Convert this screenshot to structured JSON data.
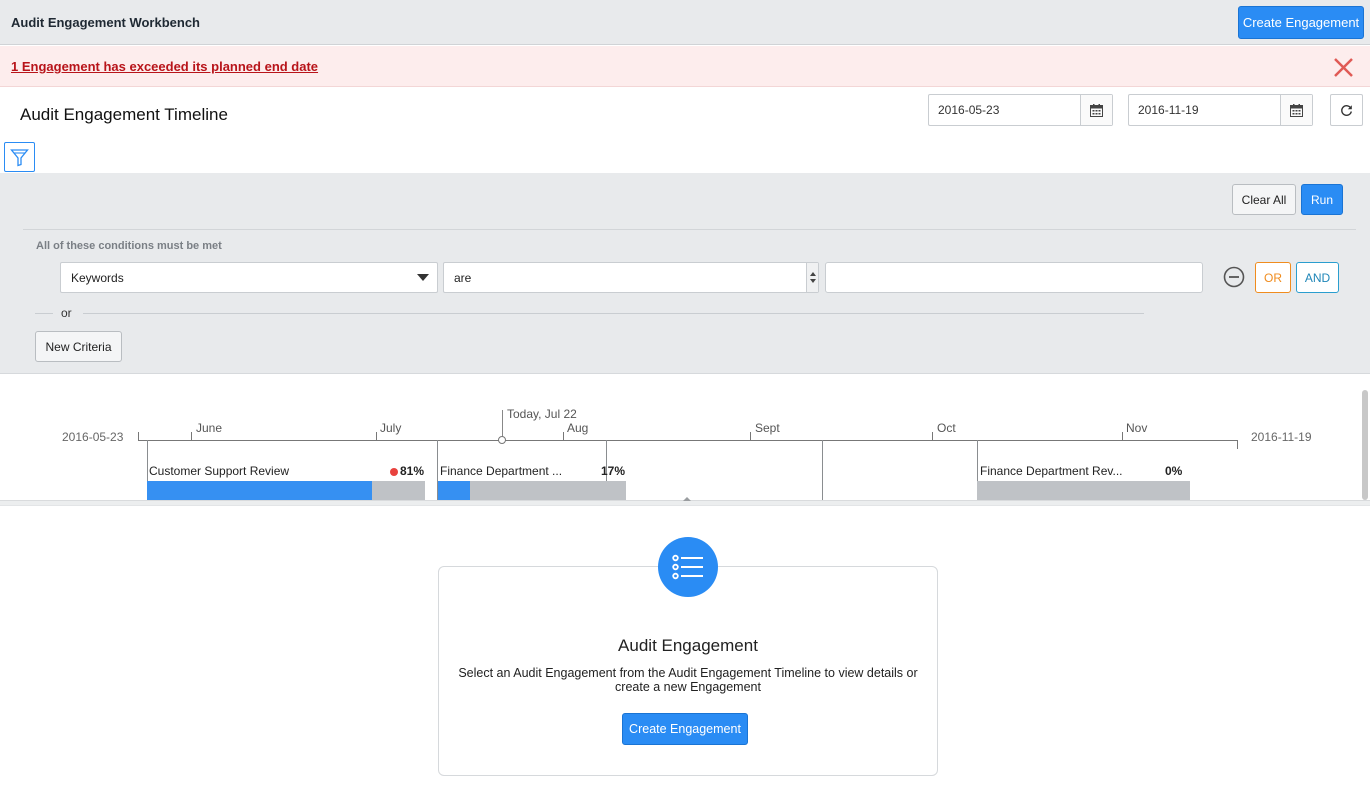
{
  "header": {
    "title": "Audit Engagement Workbench",
    "create_label": "Create Engagement"
  },
  "alert": {
    "message": "1 Engagement has exceeded its planned end date",
    "close_icon": "close-icon"
  },
  "page": {
    "title": "Audit Engagement Timeline"
  },
  "date_range": {
    "start": "2016-05-23",
    "end": "2016-11-19"
  },
  "filter": {
    "clear_all_label": "Clear All",
    "run_label": "Run",
    "conditions_label": "All of these conditions must be met",
    "field_value": "Keywords",
    "operator_value": "are",
    "text_value": "",
    "or_button": "OR",
    "and_button": "AND",
    "or_divider": "or",
    "new_criteria_label": "New Criteria"
  },
  "timeline": {
    "start_label": "2016-05-23",
    "end_label": "2016-11-19",
    "months": [
      "June",
      "July",
      "Aug",
      "Sept",
      "Oct",
      "Nov"
    ],
    "today_label": "Today, Jul 22",
    "tasks": [
      {
        "name": "Customer Support Review",
        "percent": "81%",
        "progress": 0.81,
        "overdue": true
      },
      {
        "name": "Finance Department ...",
        "percent": "17%",
        "progress": 0.17,
        "overdue": false
      },
      {
        "name": "Finance Department Rev...",
        "percent": "0%",
        "progress": 0.0,
        "overdue": false
      }
    ]
  },
  "detail": {
    "title": "Audit Engagement",
    "description": "Select an Audit Engagement from the Audit Engagement Timeline to view details or create a new Engagement",
    "create_label": "Create Engagement"
  },
  "colors": {
    "primary": "#2a8cf4",
    "alert_text": "#b8141a",
    "alert_bg": "#fdeded",
    "or_accent": "#f08c1e",
    "and_accent": "#1f86b8"
  }
}
